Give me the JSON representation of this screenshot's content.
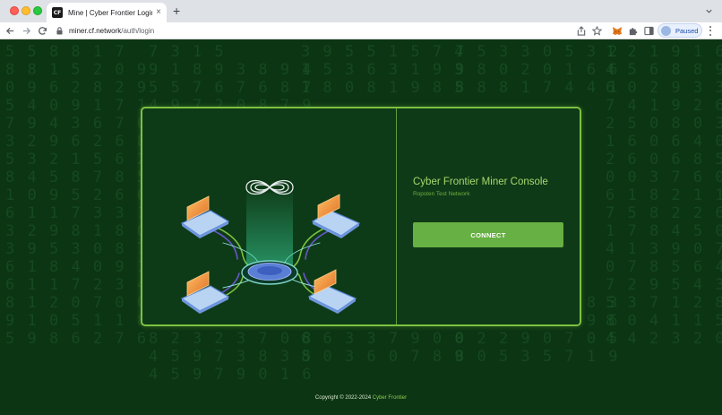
{
  "browser": {
    "tab": {
      "favicon_text": "CF",
      "title": "Mine | Cyber Frontier Login"
    },
    "url": {
      "host": "miner.cf.network",
      "path": "/auth/login"
    },
    "profile_label": "Paused"
  },
  "background": {
    "columns": [
      "5 5 8 8 1 7\n8 8 1 5 2 0 9\n0 9 6 2 8 2 9\n5 4 0 9 1 7 1\n7 9 4 3 6 7 0\n3 2 9 6 2 6 8\n5 3 2 1 5 6 2\n8 4 5 8 7 8 5\n1 0 9 5 2 6 0\n6 1 1 7 3 3 1\n3 2 9 8 1 8 0\n3 9 5 3 0 8 7\n6 1 8 4 0 9 1\n6 1 1 7 2 3 4\n8 1 2 0 7 0 0\n9 1 0 5 1 1 8\n5 9 8 6 2 7 6",
      "7 3 1 5\n9 1 8 9 3 8 9 4\n5 5 7 6 7 6 8 7\n4 9 7 2 0 8 7 9\n\n\n\n\n\n\n\n\n\n\n6 3 1 0 2 0 9 8\n6 8 1 7 2 9 5 0\n8 2 3 2 3 7 0 8\n4 5 9 7 3 8 3 5\n4 5 9 7 9 0 1 6",
      "3 9 5 5 1 5 7 4\n1 5 3 6 3 1 9 3\n1 8 0 8 1 9 8 5\n\n\n\n\n\n\n\n\n\n\n\n1 8 7 1 0 6 0 9\n5 4 6 5 3 0 7 8\n6 6 3 3 7 9 0 0\n8 0 3 6 0 7 8 9",
      "7 5 3 3 0 5 3 2\n9 8 0 2 0 1 6 6\n8 8 8 1 7 4 4 1\n\n\n\n\n\n\n\n\n\n\n\n5 7 9 6 0 9 8 3\n8 1 5 0 3 2 9 6\n0 2 2 9 0 7 0 5\n8 0 5 3 5 7 1 9",
      "1 2 1 9 1 6 9 6\n4 5 6 8 8 9 4\n6 0 2 9 3 3 8 0\n7 4 1 9 2 6 5\n2 5 0 8 0 3 1 3\n1 6 0 6 4 0 3\n2 6 0 6 8 5 1 2\n0 0 3 7 6 0 4\n6 1 8 2 1 1 6 5\n7 5 8 2 2 6 4\n1 7 8 4 5 0 3 6\n4 1 3 9 0 7 1\n0 7 8 5 6 4 9 3\n7 2 9 5 4 3 2\n5 3 7 1 2 8 9 5\n8 0 4 1 1 5 2\n4 4 2 3 2 0 5 9"
    ]
  },
  "illustration": {
    "accent": "#7dc142",
    "laptop_screen": "#f29a3a",
    "laptop_body": "#b8d4f2",
    "hub": "#5c7fd6"
  },
  "login": {
    "title": "Cyber Frontier Miner Console",
    "subtitle": "Ropsten Test Network",
    "connect_label": "CONNECT"
  },
  "footer": {
    "copyright": "Copyright © 2022-2024",
    "link_label": "Cyber Frontier"
  }
}
